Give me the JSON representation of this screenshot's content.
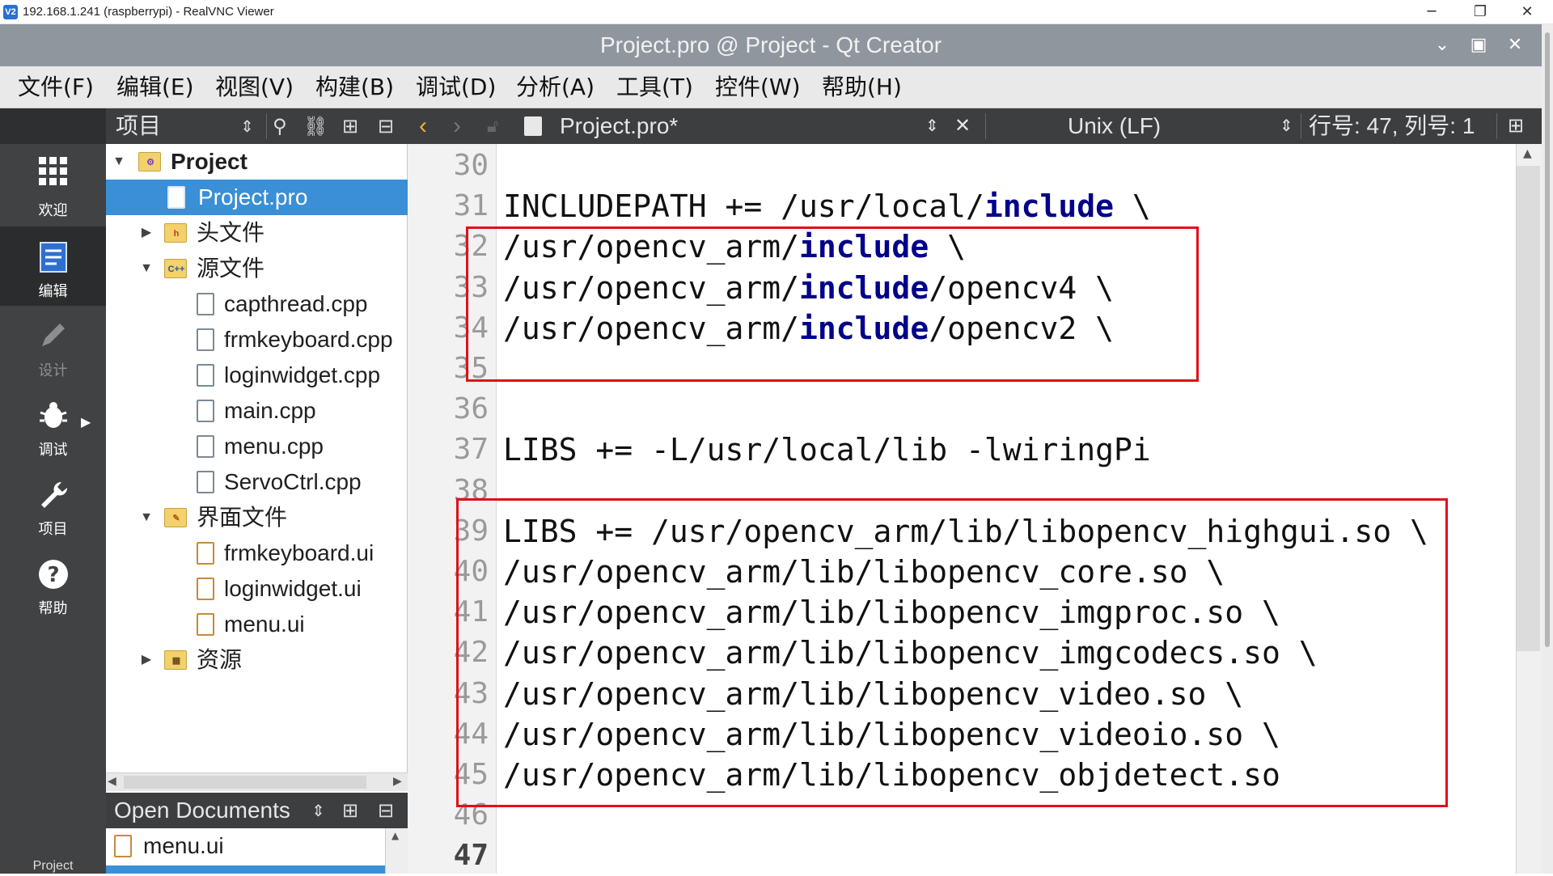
{
  "vnc": {
    "title": "192.168.1.241 (raspberrypi) - RealVNC Viewer",
    "logo": "V2"
  },
  "qt": {
    "title": "Project.pro @ Project - Qt Creator"
  },
  "menu": [
    "文件(F)",
    "编辑(E)",
    "视图(V)",
    "构建(B)",
    "调试(D)",
    "分析(A)",
    "工具(T)",
    "控件(W)",
    "帮助(H)"
  ],
  "modes": [
    {
      "label": "欢迎",
      "icon": "grid-icon"
    },
    {
      "label": "编辑",
      "icon": "edit-document-icon"
    },
    {
      "label": "设计",
      "icon": "pencil-icon"
    },
    {
      "label": "调试",
      "icon": "bug-icon"
    },
    {
      "label": "项目",
      "icon": "wrench-icon"
    },
    {
      "label": "帮助",
      "icon": "help-icon"
    }
  ],
  "modebar_bottom": "Project",
  "project_pane": {
    "title": "项目",
    "tree": [
      {
        "label": "Project",
        "depth": 0,
        "expanded": true,
        "type": "project"
      },
      {
        "label": "Project.pro",
        "depth": 1,
        "type": "pro",
        "selected": true
      },
      {
        "label": "头文件",
        "depth": 1,
        "expanded": false,
        "type": "folder-h"
      },
      {
        "label": "源文件",
        "depth": 1,
        "expanded": true,
        "type": "folder-cpp"
      },
      {
        "label": "capthread.cpp",
        "depth": 2,
        "type": "cpp"
      },
      {
        "label": "frmkeyboard.cpp",
        "depth": 2,
        "type": "cpp"
      },
      {
        "label": "loginwidget.cpp",
        "depth": 2,
        "type": "cpp"
      },
      {
        "label": "main.cpp",
        "depth": 2,
        "type": "cpp"
      },
      {
        "label": "menu.cpp",
        "depth": 2,
        "type": "cpp"
      },
      {
        "label": "ServoCtrl.cpp",
        "depth": 2,
        "type": "cpp"
      },
      {
        "label": "界面文件",
        "depth": 1,
        "expanded": true,
        "type": "folder-ui"
      },
      {
        "label": "frmkeyboard.ui",
        "depth": 2,
        "type": "ui"
      },
      {
        "label": "loginwidget.ui",
        "depth": 2,
        "type": "ui"
      },
      {
        "label": "menu.ui",
        "depth": 2,
        "type": "ui"
      },
      {
        "label": "资源",
        "depth": 1,
        "expanded": false,
        "type": "folder-res"
      }
    ]
  },
  "open_documents": {
    "title": "Open Documents",
    "items": [
      "menu.ui"
    ]
  },
  "editor": {
    "file": "Project.pro*",
    "line_ending": "Unix (LF)",
    "position": "行号: 47, 列号: 1",
    "current_line": 47,
    "lines": [
      {
        "n": 30,
        "segs": []
      },
      {
        "n": 31,
        "segs": [
          {
            "t": "INCLUDEPATH += /usr/local/"
          },
          {
            "t": "include",
            "kw": true
          },
          {
            "t": " \\"
          }
        ]
      },
      {
        "n": 32,
        "segs": [
          {
            "t": "/usr/opencv_arm/"
          },
          {
            "t": "include",
            "kw": true
          },
          {
            "t": " \\"
          }
        ]
      },
      {
        "n": 33,
        "segs": [
          {
            "t": "/usr/opencv_arm/"
          },
          {
            "t": "include",
            "kw": true
          },
          {
            "t": "/opencv4 \\"
          }
        ]
      },
      {
        "n": 34,
        "segs": [
          {
            "t": "/usr/opencv_arm/"
          },
          {
            "t": "include",
            "kw": true
          },
          {
            "t": "/opencv2 \\"
          }
        ]
      },
      {
        "n": 35,
        "segs": []
      },
      {
        "n": 36,
        "segs": []
      },
      {
        "n": 37,
        "segs": [
          {
            "t": "LIBS += -L/usr/local/lib -lwiringPi"
          }
        ]
      },
      {
        "n": 38,
        "segs": []
      },
      {
        "n": 39,
        "segs": [
          {
            "t": "LIBS += /usr/opencv_arm/lib/libopencv_highgui.so \\"
          }
        ]
      },
      {
        "n": 40,
        "segs": [
          {
            "t": "/usr/opencv_arm/lib/libopencv_core.so \\"
          }
        ]
      },
      {
        "n": 41,
        "segs": [
          {
            "t": "/usr/opencv_arm/lib/libopencv_imgproc.so \\"
          }
        ]
      },
      {
        "n": 42,
        "segs": [
          {
            "t": "/usr/opencv_arm/lib/libopencv_imgcodecs.so \\"
          }
        ]
      },
      {
        "n": 43,
        "segs": [
          {
            "t": "/usr/opencv_arm/lib/libopencv_video.so \\"
          }
        ]
      },
      {
        "n": 44,
        "segs": [
          {
            "t": "/usr/opencv_arm/lib/libopencv_videoio.so \\"
          }
        ]
      },
      {
        "n": 45,
        "segs": [
          {
            "t": "/usr/opencv_arm/lib/libopencv_objdetect.so"
          }
        ]
      },
      {
        "n": 46,
        "segs": []
      },
      {
        "n": 47,
        "segs": []
      }
    ]
  },
  "colors": {
    "highlight_box": "#e0101a",
    "keyword": "#00008b",
    "selection": "#3a8fd6"
  }
}
